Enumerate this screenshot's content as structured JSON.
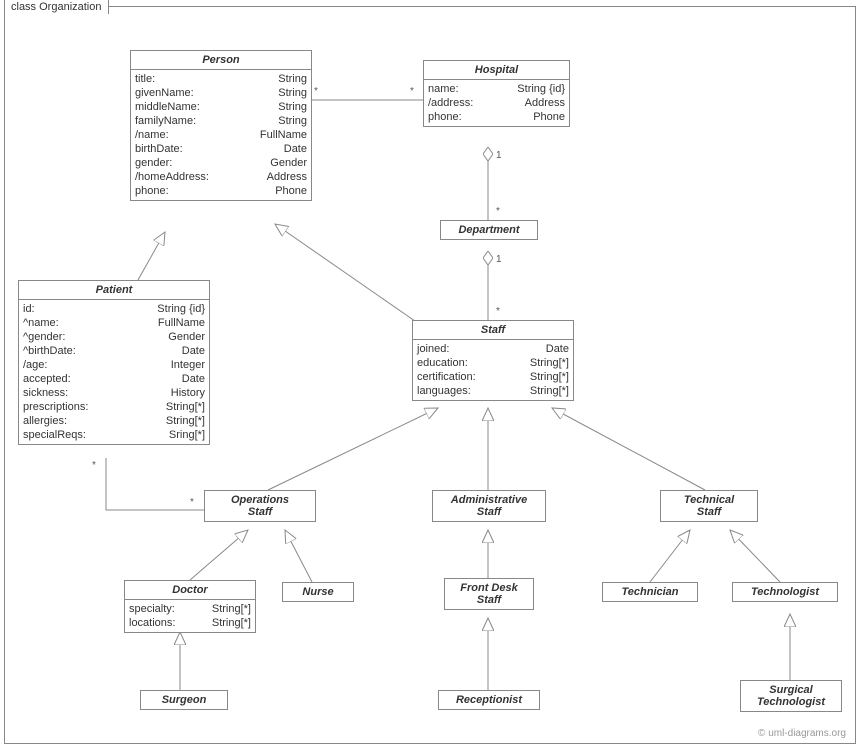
{
  "frame": {
    "title": "class Organization"
  },
  "classes": {
    "person": {
      "name": "Person",
      "attrs": [
        {
          "n": "title:",
          "t": "String"
        },
        {
          "n": "givenName:",
          "t": "String"
        },
        {
          "n": "middleName:",
          "t": "String"
        },
        {
          "n": "familyName:",
          "t": "String"
        },
        {
          "n": "/name:",
          "t": "FullName"
        },
        {
          "n": "birthDate:",
          "t": "Date"
        },
        {
          "n": "gender:",
          "t": "Gender"
        },
        {
          "n": "/homeAddress:",
          "t": "Address"
        },
        {
          "n": "phone:",
          "t": "Phone"
        }
      ]
    },
    "hospital": {
      "name": "Hospital",
      "attrs": [
        {
          "n": "name:",
          "t": "String {id}"
        },
        {
          "n": "/address:",
          "t": "Address"
        },
        {
          "n": "phone:",
          "t": "Phone"
        }
      ]
    },
    "department": {
      "name": "Department",
      "attrs": []
    },
    "patient": {
      "name": "Patient",
      "attrs": [
        {
          "n": "id:",
          "t": "String {id}"
        },
        {
          "n": "^name:",
          "t": "FullName"
        },
        {
          "n": "^gender:",
          "t": "Gender"
        },
        {
          "n": "^birthDate:",
          "t": "Date"
        },
        {
          "n": "/age:",
          "t": "Integer"
        },
        {
          "n": "accepted:",
          "t": "Date"
        },
        {
          "n": "sickness:",
          "t": "History"
        },
        {
          "n": "prescriptions:",
          "t": "String[*]"
        },
        {
          "n": "allergies:",
          "t": "String[*]"
        },
        {
          "n": "specialReqs:",
          "t": "Sring[*]"
        }
      ]
    },
    "staff": {
      "name": "Staff",
      "attrs": [
        {
          "n": "joined:",
          "t": "Date"
        },
        {
          "n": "education:",
          "t": "String[*]"
        },
        {
          "n": "certification:",
          "t": "String[*]"
        },
        {
          "n": "languages:",
          "t": "String[*]"
        }
      ]
    },
    "opsStaff": {
      "name": "Operations\nStaff",
      "attrs": []
    },
    "adminStaff": {
      "name": "Administrative\nStaff",
      "attrs": []
    },
    "techStaff": {
      "name": "Technical\nStaff",
      "attrs": []
    },
    "doctor": {
      "name": "Doctor",
      "attrs": [
        {
          "n": "specialty:",
          "t": "String[*]"
        },
        {
          "n": "locations:",
          "t": "String[*]"
        }
      ]
    },
    "nurse": {
      "name": "Nurse",
      "attrs": []
    },
    "frontDesk": {
      "name": "Front Desk\nStaff",
      "attrs": []
    },
    "technician": {
      "name": "Technician",
      "attrs": []
    },
    "technologist": {
      "name": "Technologist",
      "attrs": []
    },
    "surgeon": {
      "name": "Surgeon",
      "attrs": []
    },
    "receptionist": {
      "name": "Receptionist",
      "attrs": []
    },
    "surgTech": {
      "name": "Surgical\nTechnologist",
      "attrs": []
    }
  },
  "mults": {
    "ph_star_l": "*",
    "ph_star_r": "*",
    "hd_one": "1",
    "hd_star": "*",
    "ds_one": "1",
    "ds_star": "*",
    "po_star_l": "*",
    "po_star_r": "*"
  },
  "watermark": "© uml-diagrams.org"
}
